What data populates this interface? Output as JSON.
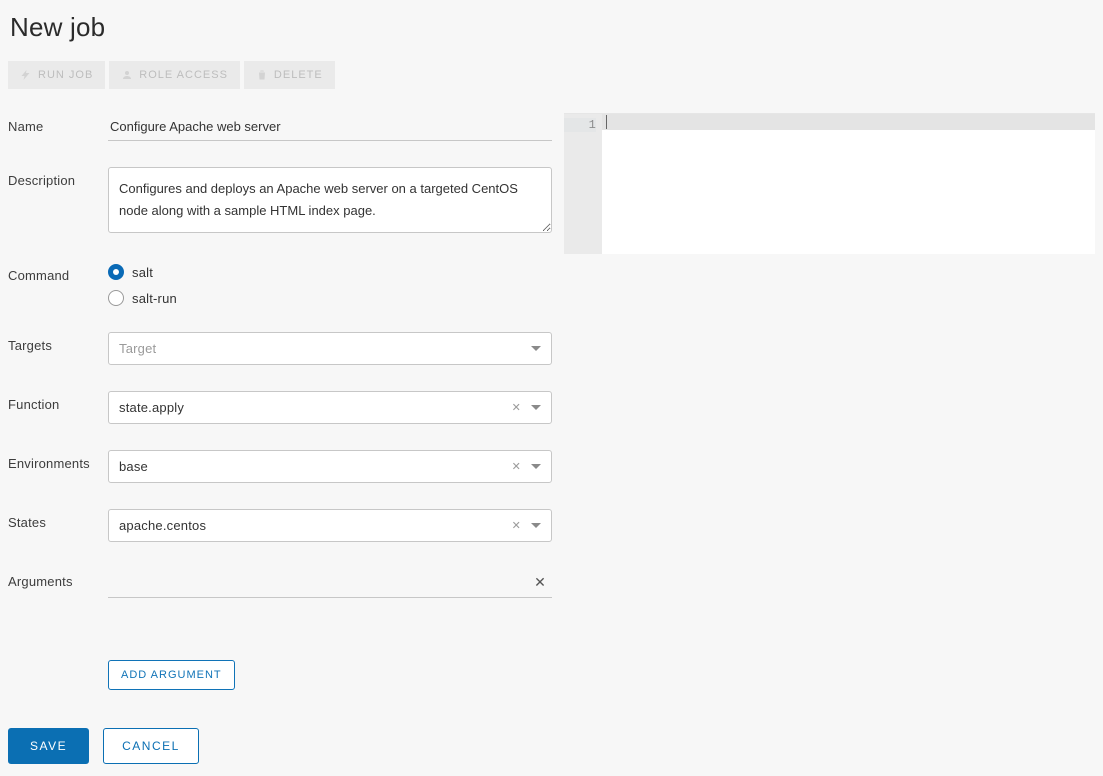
{
  "page_title": "New job",
  "toolbar": {
    "run_label": "RUN JOB",
    "role_access_label": "ROLE ACCESS",
    "delete_label": "DELETE"
  },
  "form": {
    "name": {
      "label": "Name",
      "value": "Configure Apache web server"
    },
    "description": {
      "label": "Description",
      "value": "Configures and deploys an Apache web server on a targeted CentOS node along with a sample HTML index page."
    },
    "command": {
      "label": "Command",
      "options": [
        {
          "value": "salt",
          "label": "salt",
          "checked": true
        },
        {
          "value": "salt-run",
          "label": "salt-run",
          "checked": false
        }
      ]
    },
    "targets": {
      "label": "Targets",
      "placeholder": "Target",
      "value": ""
    },
    "function": {
      "label": "Function",
      "value": "state.apply"
    },
    "environments": {
      "label": "Environments",
      "value": "base"
    },
    "states": {
      "label": "States",
      "value": "apache.centos"
    },
    "arguments": {
      "label": "Arguments",
      "value": ""
    },
    "add_argument_label": "ADD ARGUMENT"
  },
  "editor": {
    "lines": [
      "1"
    ],
    "content": ""
  },
  "footer": {
    "save_label": "SAVE",
    "cancel_label": "CANCEL"
  }
}
